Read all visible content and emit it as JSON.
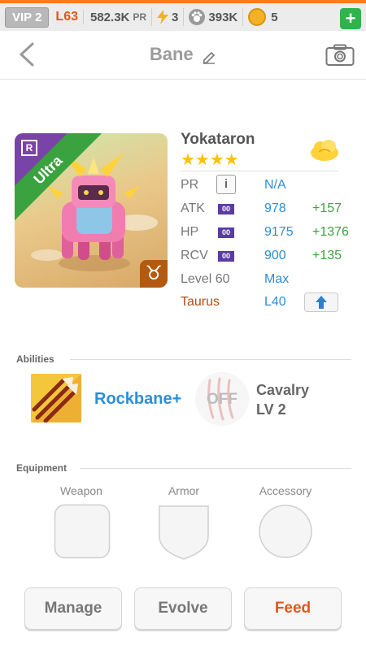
{
  "topbar": {
    "vip": "VIP 2",
    "level": "L63",
    "power": "582.3K",
    "power_label": "PR",
    "energy": "3",
    "paw_count": "393K",
    "coins": "5",
    "plus_icon": "+"
  },
  "header": {
    "title": "Bane"
  },
  "hero": {
    "name": "Yokataron",
    "stars": "★★★★",
    "rarity": "Ultra",
    "rarity_badge": "R",
    "zodiac_symbol": "♉",
    "colors": {
      "ribbon": "#3aa23e",
      "corner": "#7a43a8",
      "zodiac_bg": "#b35a10"
    }
  },
  "stats": {
    "pr": {
      "label": "PR",
      "value": "N/A",
      "info": "i"
    },
    "atk": {
      "label": "ATK",
      "badge": "00",
      "value": "978",
      "bonus": "+157"
    },
    "hp": {
      "label": "HP",
      "badge": "00",
      "value": "9175",
      "bonus": "+1376"
    },
    "rcv": {
      "label": "RCV",
      "badge": "00",
      "value": "900",
      "bonus": "+135"
    },
    "level": {
      "label": "Level 60",
      "value": "Max"
    },
    "zodiac": {
      "label": "Taurus",
      "value": "L40"
    }
  },
  "abilities": {
    "heading": "Abilities",
    "skill_name": "Rockbane+",
    "passive_state": "OFF",
    "passive_name": "Cavalry",
    "passive_level": "LV 2"
  },
  "equipment": {
    "heading": "Equipment",
    "slots": [
      "Weapon",
      "Armor",
      "Accessory"
    ]
  },
  "actions": {
    "manage": "Manage",
    "evolve": "Evolve",
    "feed": "Feed"
  }
}
